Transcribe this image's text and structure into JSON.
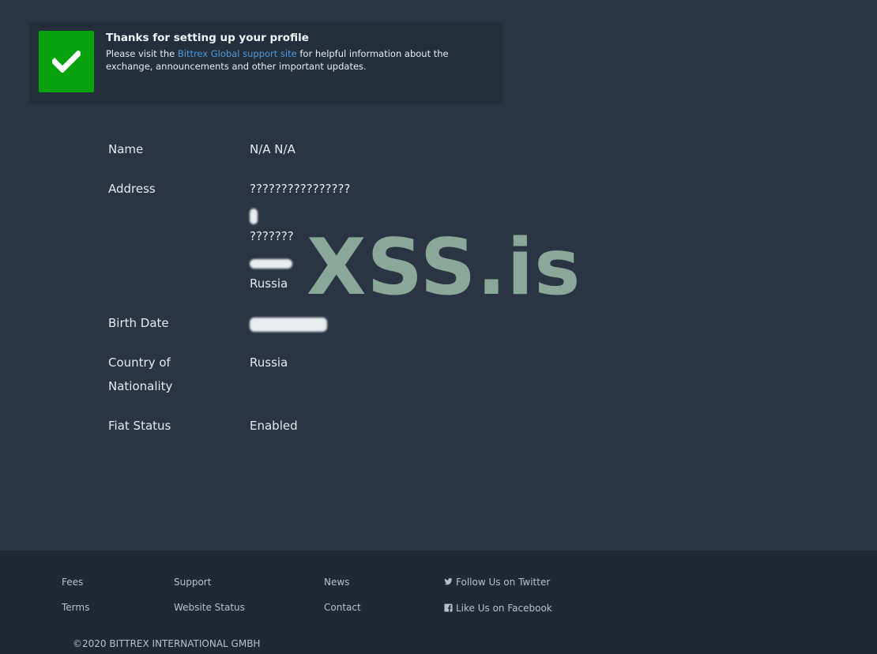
{
  "notice": {
    "title": "Thanks for setting up your profile",
    "body_before": "Please visit the ",
    "link_text": "Bittrex Global support site",
    "body_after": " for helpful information about the exchange, announcements and other important updates."
  },
  "profile": {
    "name_label": "Name",
    "name_value": "N/A N/A",
    "address_label": "Address",
    "address_line1": "????????????????",
    "address_line3": "???????",
    "address_country": "Russia",
    "birth_label": "Birth Date",
    "nationality_label_1": "Country of",
    "nationality_label_2": "Nationality",
    "nationality_value": "Russia",
    "fiat_label": "Fiat Status",
    "fiat_value": "Enabled"
  },
  "watermark": "XSS.is",
  "footer": {
    "fees": "Fees",
    "terms": "Terms",
    "support": "Support",
    "website_status": "Website Status",
    "news": "News",
    "contact": "Contact",
    "twitter": "Follow Us on Twitter",
    "facebook": "Like Us on Facebook",
    "copyright": "©2020 BITTREX INTERNATIONAL GMBH"
  },
  "colors": {
    "page_bg": "#2a3442",
    "footer_bg": "#1f2834",
    "success": "#06a30f",
    "link": "#4c9be0",
    "watermark": "#8aa899"
  },
  "icons": [
    "check-icon",
    "twitter-icon",
    "facebook-icon"
  ]
}
